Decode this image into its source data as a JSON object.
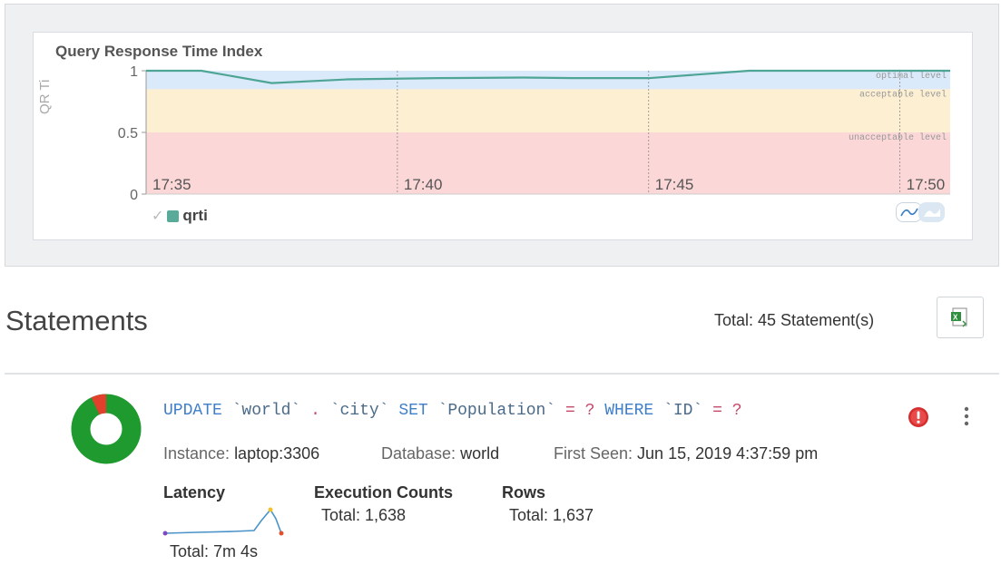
{
  "chart_data": {
    "type": "line",
    "title": "Query Response Time Index",
    "ylabel": "QR Ti",
    "ylim": [
      0,
      1
    ],
    "yticks": [
      "0",
      "0.5",
      "1"
    ],
    "xticks": [
      "17:35",
      "17:40",
      "17:45",
      "17:50"
    ],
    "bands": [
      {
        "label": "optimal level",
        "from": 0.85,
        "to": 1.0,
        "color": "#dbeafa"
      },
      {
        "label": "acceptable level",
        "from": 0.5,
        "to": 0.85,
        "color": "#fcefd2"
      },
      {
        "label": "unacceptable level",
        "from": 0.0,
        "to": 0.5,
        "color": "#fbd7d7"
      }
    ],
    "series": [
      {
        "name": "qrti",
        "color": "#4ea595",
        "x": [
          0.0,
          1.1,
          2.5,
          4.0,
          5.8,
          7.5,
          8.5,
          10.0,
          12.0,
          15.0,
          16.0
        ],
        "y": [
          1.0,
          1.0,
          0.9,
          0.93,
          0.94,
          0.945,
          0.94,
          0.94,
          1.0,
          1.0,
          1.0
        ]
      }
    ],
    "legend": [
      "qrti"
    ],
    "legend_check": "✓",
    "grid": false
  },
  "statements": {
    "title": "Statements",
    "total_text": "Total: 45 Statement(s)",
    "export_icon": "excel-export-icon"
  },
  "statement": {
    "sql_tokens": [
      {
        "t": "UPDATE",
        "c": "kw"
      },
      {
        "t": " ",
        "c": ""
      },
      {
        "t": "`world`",
        "c": "id"
      },
      {
        "t": " ",
        "c": ""
      },
      {
        "t": ".",
        "c": "op"
      },
      {
        "t": " ",
        "c": ""
      },
      {
        "t": "`city`",
        "c": "id"
      },
      {
        "t": " ",
        "c": ""
      },
      {
        "t": "SET",
        "c": "kw"
      },
      {
        "t": " ",
        "c": ""
      },
      {
        "t": "`Population`",
        "c": "id"
      },
      {
        "t": " ",
        "c": ""
      },
      {
        "t": "=",
        "c": "op"
      },
      {
        "t": " ",
        "c": ""
      },
      {
        "t": "?",
        "c": "op"
      },
      {
        "t": " ",
        "c": ""
      },
      {
        "t": "WHERE",
        "c": "kw"
      },
      {
        "t": " ",
        "c": ""
      },
      {
        "t": "`ID`",
        "c": "id"
      },
      {
        "t": " ",
        "c": ""
      },
      {
        "t": "=",
        "c": "op"
      },
      {
        "t": " ",
        "c": ""
      },
      {
        "t": "?",
        "c": "op"
      }
    ],
    "donut": {
      "green_fraction": 0.93,
      "red_fraction": 0.07,
      "green": "#1e9a2e",
      "red": "#e0402c"
    },
    "instance_label": "Instance:",
    "instance_value": "laptop:3306",
    "database_label": "Database:",
    "database_value": "world",
    "first_seen_label": "First Seen:",
    "first_seen_value": "Jun 15, 2019 4:37:59 pm",
    "latency_label": "Latency",
    "latency_total": "Total: 7m 4s",
    "exec_label": "Execution Counts",
    "exec_total": "Total: 1,638",
    "rows_label": "Rows",
    "rows_total": "Total: 1,637",
    "alert_icon": "error-alert-icon",
    "menu_icon": "kebab-menu-icon"
  }
}
